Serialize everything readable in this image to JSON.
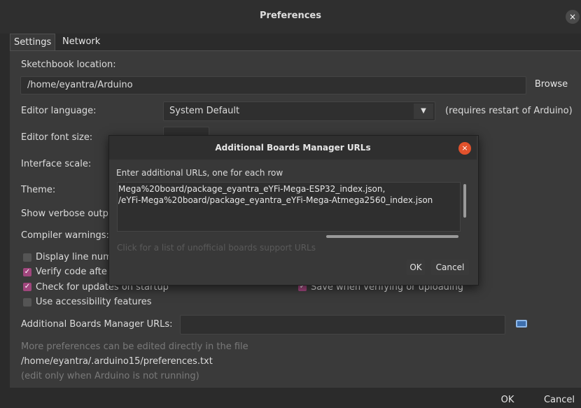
{
  "window": {
    "title": "Preferences",
    "close_glyph": "×"
  },
  "tabs": [
    {
      "label": "Settings"
    },
    {
      "label": "Network"
    }
  ],
  "settings": {
    "sketchbook_label": "Sketchbook location:",
    "sketchbook_value": "/home/eyantra/Arduino",
    "browse": "Browse",
    "editor_language_label": "Editor language:",
    "editor_language_value": "System Default",
    "restart_note": "(requires restart of Arduino)",
    "font_size_label": "Editor font size:",
    "interface_scale_label": "Interface scale:",
    "theme_label": "Theme:",
    "verbose_label": "Show verbose outp",
    "compiler_label": "Compiler warnings:",
    "checkboxes": [
      {
        "label": "Display line num",
        "checked": false
      },
      {
        "label": "Verify code afte",
        "checked": true
      },
      {
        "label": "Check for updates on startup",
        "checked": true
      },
      {
        "label": "Use accessibility features",
        "checked": false
      },
      {
        "label": "Save when verifying or uploading",
        "checked": true
      }
    ],
    "boards_label": "Additional Boards Manager URLs:",
    "boards_value": "",
    "more_prefs": "More preferences can be edited directly in the file",
    "prefs_path": "/home/eyantra/.arduino15/preferences.txt",
    "edit_note": "(edit only when Arduino is not running)"
  },
  "footer": {
    "ok": "OK",
    "cancel": "Cancel"
  },
  "dialog": {
    "title": "Additional Boards Manager URLs",
    "close_glyph": "×",
    "instructions": "Enter additional URLs, one for each row",
    "urls": [
      "Mega%20board/package_eyantra_eYFi-Mega-ESP32_index.json,",
      "/eYFi-Mega%20board/package_eyantra_eYFi-Mega-Atmega2560_index.json"
    ],
    "link": "Click for a list of unofficial boards support URLs",
    "ok": "OK",
    "cancel": "Cancel"
  },
  "colors": {
    "accent": "#a0467d",
    "dialog_close": "#e2522c"
  }
}
